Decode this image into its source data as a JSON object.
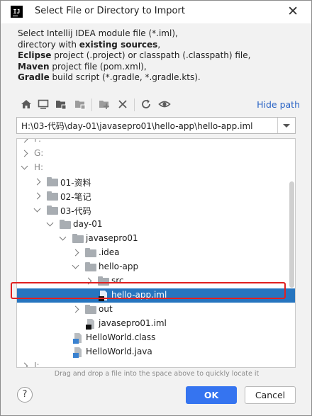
{
  "dialog": {
    "title": "Select File or Directory to Import",
    "app_icon_text": "IJ"
  },
  "description": {
    "line1": "Select Intellij IDEA module file (*.iml),",
    "line2_prefix": "directory with ",
    "line2_bold": "existing sources",
    "line2_suffix": ",",
    "line3_bold": "Eclipse",
    "line3_suffix": " project (.project) or classpath (.classpath) file,",
    "line4_bold": "Maven",
    "line4_suffix": " project file (pom.xml),",
    "line5_bold": "Gradle",
    "line5_suffix": " build script (*.gradle, *.gradle.kts)."
  },
  "toolbar": {
    "icons": [
      "home-icon",
      "desktop-icon",
      "project-folder-icon",
      "module-folder-icon",
      "new-folder-icon",
      "delete-icon",
      "refresh-icon",
      "show-hidden-icon"
    ],
    "hide_path_label": "Hide path"
  },
  "path": {
    "value": "H:\\03-代码\\day-01\\javasepro01\\hello-app\\hello-app.iml"
  },
  "tree": {
    "rows": [
      {
        "label": "F:",
        "depth": 0,
        "arrow": "right",
        "icon": "none",
        "faded": true
      },
      {
        "label": "G:",
        "depth": 0,
        "arrow": "right",
        "icon": "none",
        "faded": true
      },
      {
        "label": "H:",
        "depth": 0,
        "arrow": "down",
        "icon": "none",
        "faded": true
      },
      {
        "label": "01-资料",
        "depth": 1,
        "arrow": "right",
        "icon": "folder"
      },
      {
        "label": "02-笔记",
        "depth": 1,
        "arrow": "right",
        "icon": "folder"
      },
      {
        "label": "03-代码",
        "depth": 1,
        "arrow": "down",
        "icon": "folder"
      },
      {
        "label": "day-01",
        "depth": 2,
        "arrow": "down",
        "icon": "folder"
      },
      {
        "label": "javasepro01",
        "depth": 3,
        "arrow": "down",
        "icon": "folder"
      },
      {
        "label": ".idea",
        "depth": 4,
        "arrow": "right",
        "icon": "folder"
      },
      {
        "label": "hello-app",
        "depth": 4,
        "arrow": "down",
        "icon": "folder"
      },
      {
        "label": "src",
        "depth": 5,
        "arrow": "right",
        "icon": "folder"
      },
      {
        "label": "hello-app.iml",
        "depth": 5,
        "arrow": "none",
        "icon": "iml",
        "selected": true
      },
      {
        "label": "out",
        "depth": 4,
        "arrow": "right",
        "icon": "folder"
      },
      {
        "label": "javasepro01.iml",
        "depth": 4,
        "arrow": "none",
        "icon": "iml"
      },
      {
        "label": "HelloWorld.class",
        "depth": 3,
        "arrow": "none",
        "icon": "class"
      },
      {
        "label": "HelloWorld.java",
        "depth": 3,
        "arrow": "none",
        "icon": "java"
      },
      {
        "label": "I:",
        "depth": 0,
        "arrow": "right",
        "icon": "none",
        "faded": true
      }
    ]
  },
  "hint": "Drag and drop a file into the space above to quickly locate it",
  "buttons": {
    "help": "?",
    "ok": "OK",
    "cancel": "Cancel"
  },
  "colors": {
    "selection": "#2675bf",
    "link": "#2a64c5",
    "primary_button": "#3574f0",
    "annotation_box": "#e02020"
  }
}
